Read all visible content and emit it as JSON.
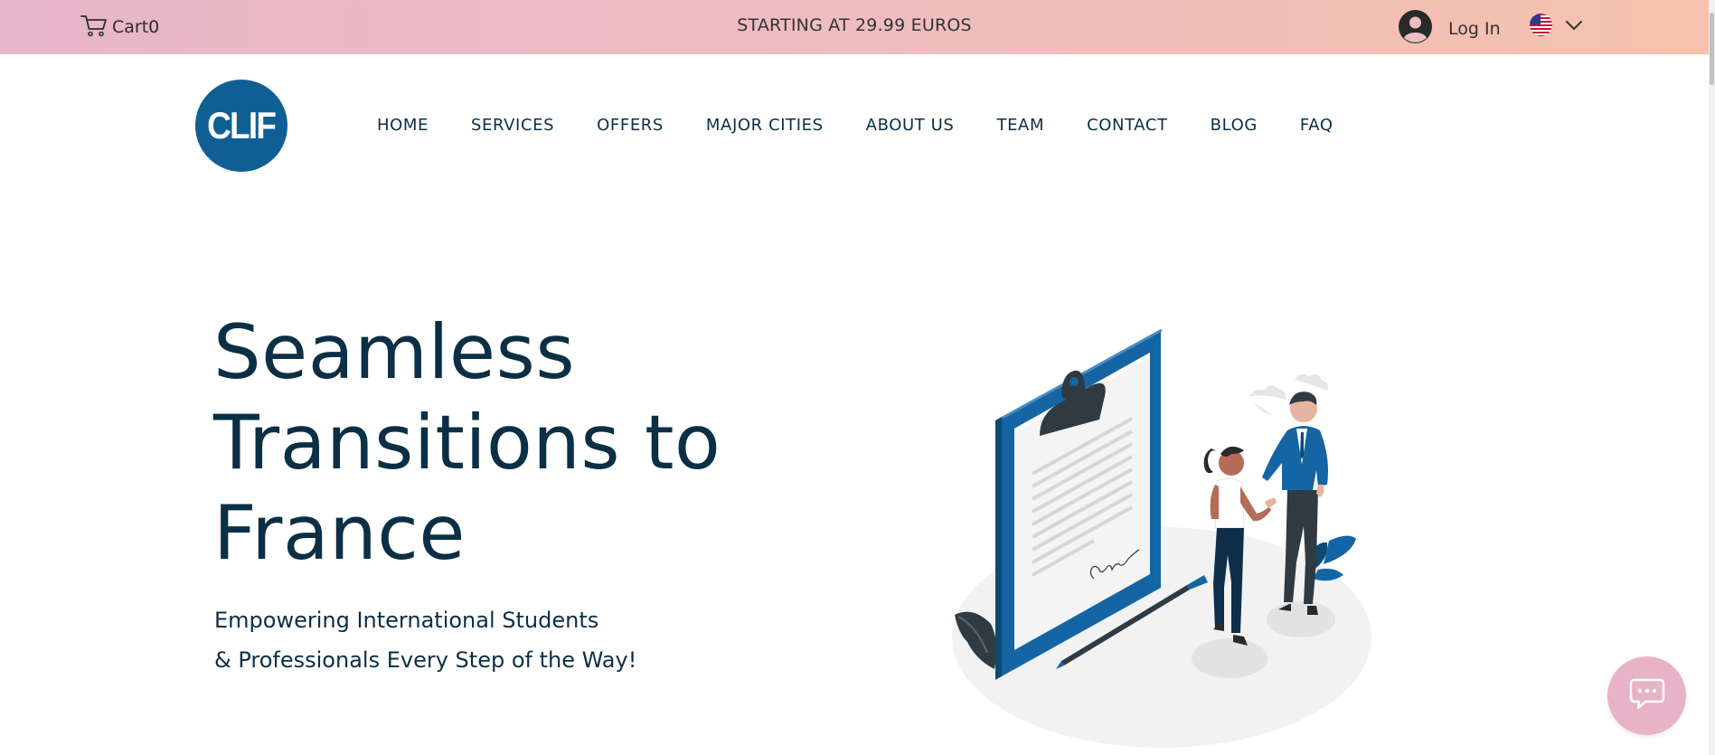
{
  "topbar": {
    "cart_label": "Cart",
    "cart_count": "0",
    "promo_text": "STARTING AT 29.99 EUROS",
    "login_label": "Log In",
    "language_flag": "us-flag-icon"
  },
  "header": {
    "logo_text": "CLIF",
    "nav": [
      {
        "label": "HOME"
      },
      {
        "label": "SERVICES"
      },
      {
        "label": "OFFERS"
      },
      {
        "label": "MAJOR CITIES"
      },
      {
        "label": "ABOUT US"
      },
      {
        "label": "TEAM"
      },
      {
        "label": "CONTACT"
      },
      {
        "label": "BLOG"
      },
      {
        "label": "FAQ"
      }
    ]
  },
  "hero": {
    "title_lines": [
      "Seamless",
      "Transitions to",
      "France"
    ],
    "subtitle_lines": [
      "Empowering International Students",
      "& Professionals Every Step of the Way!"
    ]
  },
  "colors": {
    "brand_blue": "#0f5f95",
    "text_dark": "#0b2f45",
    "topbar_gradient_start": "#e7b6c9",
    "topbar_gradient_end": "#f6c2ad",
    "chat_button": "#e8b3c6"
  },
  "icons": {
    "cart": "cart-icon",
    "account": "account-icon",
    "chevron": "chevron-down-icon",
    "chat": "chat-icon"
  }
}
